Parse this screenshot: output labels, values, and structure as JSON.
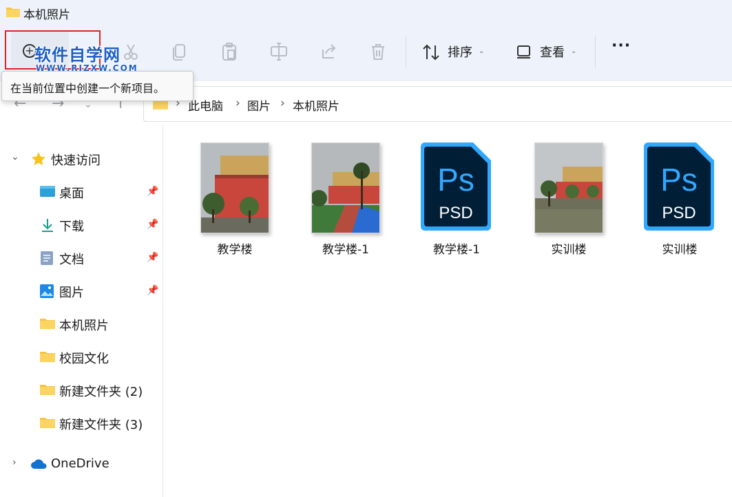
{
  "window": {
    "title": "本机照片"
  },
  "toolbar": {
    "new_tooltip": "在当前位置中创建一个新项目。",
    "sort_label": "排序",
    "view_label": "查看",
    "more_label": "···"
  },
  "watermark": {
    "main": "软件自学网",
    "sub": "WWW.RJZXW.COM"
  },
  "breadcrumb": [
    "此电脑",
    "图片",
    "本机照片"
  ],
  "sidebar": {
    "quick_access": "快速访问",
    "items": [
      {
        "label": "桌面",
        "icon": "desktop-icon",
        "pinned": true
      },
      {
        "label": "下载",
        "icon": "download-icon",
        "pinned": true
      },
      {
        "label": "文档",
        "icon": "document-icon",
        "pinned": true
      },
      {
        "label": "图片",
        "icon": "pictures-icon",
        "pinned": true
      },
      {
        "label": "本机照片",
        "icon": "folder-icon",
        "pinned": false
      },
      {
        "label": "校园文化",
        "icon": "folder-icon",
        "pinned": false
      },
      {
        "label": "新建文件夹 (2)",
        "icon": "folder-icon",
        "pinned": false
      },
      {
        "label": "新建文件夹 (3)",
        "icon": "folder-icon",
        "pinned": false
      }
    ],
    "onedrive": "OneDrive"
  },
  "files": [
    {
      "name": "教学楼",
      "type": "photo"
    },
    {
      "name": "教学楼-1",
      "type": "photo"
    },
    {
      "name": "教学楼-1",
      "type": "psd",
      "psd_top": "Ps",
      "psd_bottom": "PSD"
    },
    {
      "name": "实训楼",
      "type": "photo"
    },
    {
      "name": "实训楼",
      "type": "psd",
      "psd_top": "Ps",
      "psd_bottom": "PSD"
    }
  ],
  "colors": {
    "accent": "#1d5fc4",
    "highlight_box": "#e02424",
    "folder": "#f5c542",
    "psd_bg": "#001e36",
    "psd_accent": "#31a8ff"
  }
}
